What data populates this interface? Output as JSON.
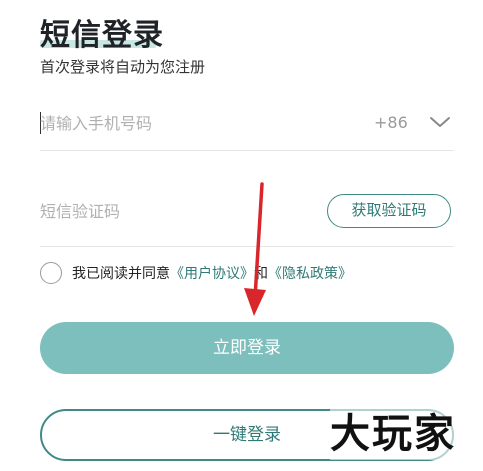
{
  "header": {
    "title": "短信登录",
    "subtitle": "首次登录将自动为您注册"
  },
  "phone": {
    "placeholder": "请输入手机号码",
    "value": "",
    "country_code": "+86",
    "dropdown_icon": "chevron-down-icon"
  },
  "sms_code": {
    "placeholder": "短信验证码",
    "value": "",
    "get_code_label": "获取验证码"
  },
  "agreement": {
    "checked": false,
    "prefix": "我已阅读并同意",
    "user_agreement": "《用户协议》",
    "conjunction": "和",
    "privacy_policy": "《隐私政策》"
  },
  "actions": {
    "login_label": "立即登录",
    "one_click_label": "一键登录"
  },
  "watermark": {
    "text": "大玩家"
  },
  "annotation": {
    "icon": "red-arrow-icon",
    "color": "#d9262b"
  },
  "colors": {
    "accent": "#2f7a76",
    "primary_button": "#7cbfbc",
    "title_highlight": "#c7e6e4"
  }
}
